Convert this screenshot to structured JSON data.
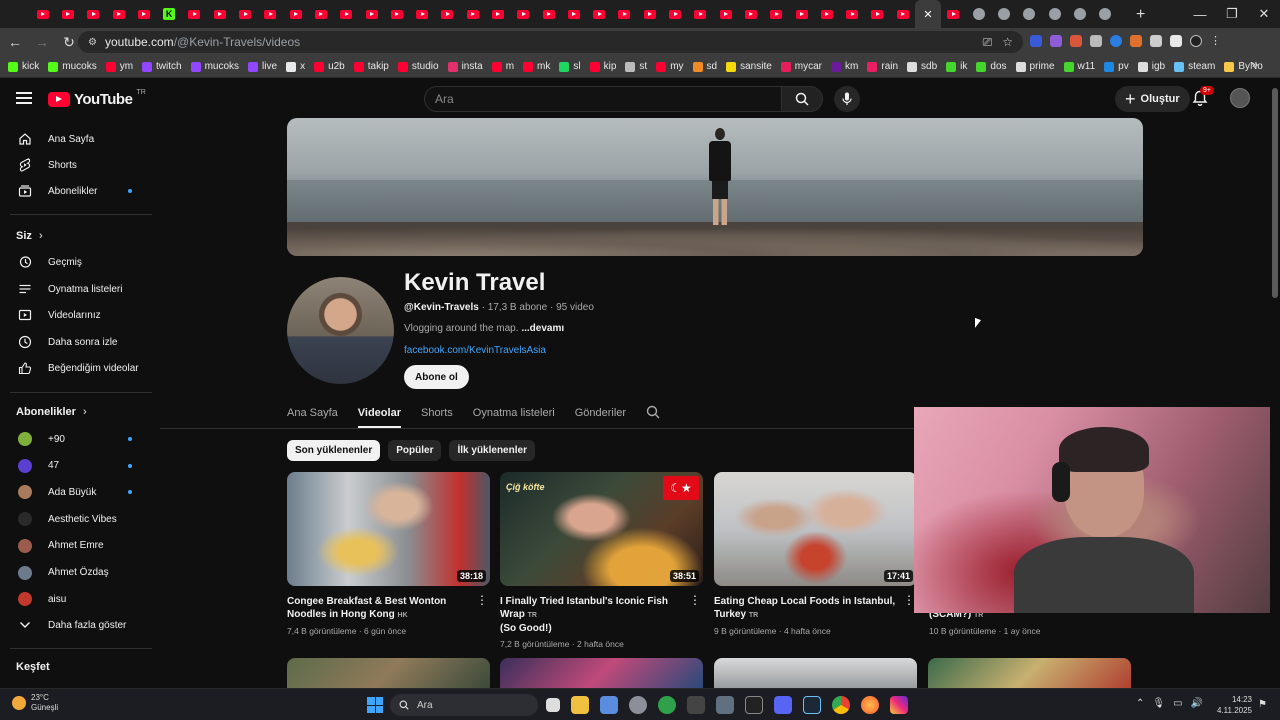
{
  "browser": {
    "url_host": "youtube.com",
    "url_path": "/@Kevin-Travels/videos",
    "close_tab": "✕",
    "new_tab": "+"
  },
  "bookmarks": [
    {
      "label": "kick",
      "color": "#53fc18"
    },
    {
      "label": "mucoks",
      "color": "#53fc18"
    },
    {
      "label": "ym",
      "color": "#ff0033"
    },
    {
      "label": "twitch",
      "color": "#9146ff"
    },
    {
      "label": "mucoks",
      "color": "#9146ff"
    },
    {
      "label": "live",
      "color": "#9146ff"
    },
    {
      "label": "x",
      "color": "#e7e9ea"
    },
    {
      "label": "u2b",
      "color": "#ff0033"
    },
    {
      "label": "takip",
      "color": "#ff0033"
    },
    {
      "label": "studio",
      "color": "#ff0033"
    },
    {
      "label": "insta",
      "color": "#e1306c"
    },
    {
      "label": "m",
      "color": "#ff0033"
    },
    {
      "label": "mk",
      "color": "#ff0033"
    },
    {
      "label": "sl",
      "color": "#1ed760"
    },
    {
      "label": "kip",
      "color": "#ff0033"
    },
    {
      "label": "st",
      "color": "#bbbbbb"
    },
    {
      "label": "my",
      "color": "#ff0033"
    },
    {
      "label": "sd",
      "color": "#f08a24"
    },
    {
      "label": "sansite",
      "color": "#f5d90a"
    },
    {
      "label": "mycar",
      "color": "#e61e5a"
    },
    {
      "label": "km",
      "color": "#6a1b9a"
    },
    {
      "label": "rain",
      "color": "#e91e63"
    },
    {
      "label": "sdb",
      "color": "#dddddd"
    },
    {
      "label": "ik",
      "color": "#44d62c"
    },
    {
      "label": "dos",
      "color": "#44d62c"
    },
    {
      "label": "prime",
      "color": "#dddddd"
    },
    {
      "label": "w11",
      "color": "#44d62c"
    },
    {
      "label": "pv",
      "color": "#1e88e5"
    },
    {
      "label": "igb",
      "color": "#dddddd"
    },
    {
      "label": "steam",
      "color": "#66c0f4"
    },
    {
      "label": "ByNo",
      "color": "#f7c948"
    }
  ],
  "yt": {
    "logo_word": "YouTube",
    "logo_region": "TR",
    "search_placeholder": "Ara",
    "create_label": "Oluştur",
    "notif_badge": "9+"
  },
  "sidebar": {
    "main": [
      {
        "label": "Ana Sayfa",
        "icon": "home-icon"
      },
      {
        "label": "Shorts",
        "icon": "shorts-icon"
      },
      {
        "label": "Abonelikler",
        "icon": "subscriptions-icon"
      }
    ],
    "you_heading": "Siz",
    "you": [
      {
        "label": "Geçmiş"
      },
      {
        "label": "Oynatma listeleri"
      },
      {
        "label": "Videolarınız"
      },
      {
        "label": "Daha sonra izle"
      },
      {
        "label": "Beğendiğim videolar"
      }
    ],
    "subs_heading": "Abonelikler",
    "subs": [
      {
        "label": "+90",
        "dot": true,
        "color": "#7fb13a"
      },
      {
        "label": "47",
        "dot": true,
        "color": "#5b3fd1"
      },
      {
        "label": "Ada Büyük",
        "dot": true,
        "color": "#a87b5c"
      },
      {
        "label": "Aesthetic Vibes",
        "dot": false,
        "color": "#2a2a2a"
      },
      {
        "label": "Ahmet Emre",
        "dot": false,
        "color": "#9b5c4d"
      },
      {
        "label": "Ahmet Özdaş",
        "dot": false,
        "color": "#6d7a8c"
      },
      {
        "label": "aisu",
        "dot": false,
        "color": "#c0392b"
      }
    ],
    "show_more": "Daha fazla göster",
    "explore_heading": "Keşfet"
  },
  "channel": {
    "name": "Kevin Travel",
    "handle": "@Kevin-Travels",
    "subs": "17,3 B abone",
    "videos": "95 video",
    "description": "Vlogging around the map.",
    "more": "...devamı",
    "link": "facebook.com/KevinTravelsAsia",
    "subscribe": "Abone ol"
  },
  "tabs": [
    "Ana Sayfa",
    "Videolar",
    "Shorts",
    "Oynatma listeleri",
    "Gönderiler"
  ],
  "chips": [
    "Son yüklenenler",
    "Popüler",
    "İlk yüklenenler"
  ],
  "videos": [
    {
      "title": "Congee Breakfast & Best Wonton Noodles in Hong Kong",
      "tag": "HK",
      "duration": "38:18",
      "views": "7,4 B görüntüleme",
      "age": "6 gün önce"
    },
    {
      "title": "I Finally Tried Istanbul's Iconic Fish Wrap",
      "tag": "TR",
      "title2": "(So Good!)",
      "duration": "38:51",
      "views": "7,2 B görüntüleme",
      "age": "2 hafta önce"
    },
    {
      "title": "Eating Cheap Local Foods in Istanbul, Turkey",
      "tag": "TR",
      "duration": "17:41",
      "views": "9 B görüntüleme",
      "age": "4 hafta önce"
    },
    {
      "title": "(SCAM?)",
      "tag": "TR",
      "views": "10 B görüntüleme",
      "age": "1 ay önce"
    }
  ],
  "thumb_overlay_text": "Çiğ köfte",
  "taskbar": {
    "temp": "23°C",
    "weather": "Güneşli",
    "search": "Ara",
    "time": "14:23",
    "date": "4.11.2025"
  }
}
